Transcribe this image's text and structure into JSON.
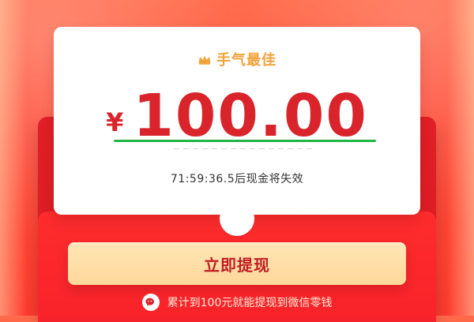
{
  "colors": {
    "bg_top": "#ff6a4a",
    "bg_bottom": "#ff3b2f",
    "envelope": "#e21f26",
    "card": "#ffffff",
    "amount_red": "#d8242a",
    "gold_text": "#f2a23b",
    "button_gold": "#ffd79a",
    "button_text": "#c01d22",
    "underline_green": "#20b544"
  },
  "badge": {
    "icon": "crown-icon",
    "label": "手气最佳"
  },
  "amount": {
    "currency_symbol": "¥",
    "value": "100.00"
  },
  "countdown": {
    "text": "71:59:36.5后现金将失效"
  },
  "actions": {
    "withdraw_label": "立即提现"
  },
  "footer": {
    "icon": "wechat-icon",
    "text": "累计到100元就能提现到微信零钱"
  }
}
